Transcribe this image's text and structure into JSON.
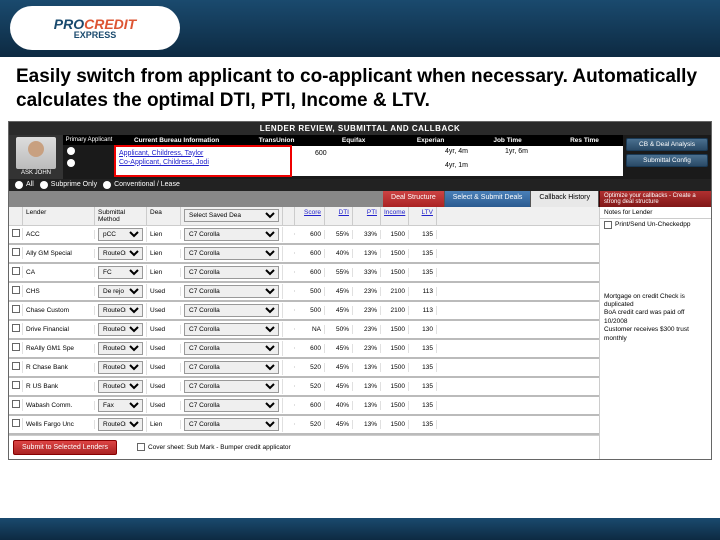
{
  "logo": {
    "line1": "PROCREDIT",
    "line2": "EXPRESS"
  },
  "headline": "Easily switch from applicant to co-applicant when necessary. Automatically calculates the optimal DTI, PTI, Income & LTV.",
  "app_title": "LENDER REVIEW, SUBMITTAL AND CALLBACK",
  "avatar_label": "ASK JOHN",
  "primary_header": "Primary Applicant",
  "bureau_headers": {
    "cb": "Current Bureau Information",
    "trans": "TransUnion",
    "equifax": "Equifax",
    "experian": "Experian",
    "job": "Job Time",
    "res": "Res Time"
  },
  "applicants": {
    "primary": {
      "name": "Applicant, Childress, Taylor",
      "trans": "",
      "equifax": "",
      "experian": "",
      "job": "4yr, 4m",
      "res": "1yr, 6m"
    },
    "co": {
      "name": "Co-Applicant, Childress, Jodi",
      "trans": "600",
      "equifax": "",
      "experian": "",
      "job": "4yr, 1m",
      "res": ""
    }
  },
  "right_buttons": {
    "cb": "CB & Deal Analysis",
    "submittal": "Submittal Config"
  },
  "filter": {
    "all": "All",
    "subprime": "Subprime Only",
    "conventional": "Conventional / Lease"
  },
  "tabs": {
    "deal": "Deal Structure",
    "select": "Select & Submit Deals",
    "callback": "Callback History"
  },
  "opt_banner": "Optimize your callbacks - Create a strong deal structure",
  "grid_headers": {
    "lender": "Lender",
    "method": "Submittal Method",
    "dea": "Dea",
    "deal_select": "Select Saved Dea",
    "score": "Score",
    "dti": "DTI",
    "pti": "PTI",
    "income": "Income",
    "ltv": "LTV"
  },
  "notes_header": "Notes for Lender",
  "print_label": "Print/Send Un-Checkedpp",
  "lenders": [
    {
      "name": "ACC",
      "method": "pCC",
      "dea": "Lien",
      "deal": "C7 Corolla",
      "score": "600",
      "dti": "55%",
      "pti": "33%",
      "income": "1500",
      "ltv": "135"
    },
    {
      "name": "Ally GM Special",
      "method": "RouteOne",
      "dea": "Lien",
      "deal": "C7 Corolla",
      "score": "600",
      "dti": "40%",
      "pti": "13%",
      "income": "1500",
      "ltv": "135"
    },
    {
      "name": "CA",
      "method": "FC",
      "dea": "Lien",
      "deal": "C7 Corolla",
      "score": "600",
      "dti": "55%",
      "pti": "33%",
      "income": "1500",
      "ltv": "135"
    },
    {
      "name": "CHS",
      "method": "De rejo",
      "dea": "Used",
      "deal": "C7 Corolla",
      "score": "500",
      "dti": "45%",
      "pti": "23%",
      "income": "2100",
      "ltv": "113"
    },
    {
      "name": "Chase Custom",
      "method": "RouteOne",
      "dea": "Used",
      "deal": "C7 Corolla",
      "score": "500",
      "dti": "45%",
      "pti": "23%",
      "income": "2100",
      "ltv": "113"
    },
    {
      "name": "Drive Financial",
      "method": "RouteOne",
      "dea": "Used",
      "deal": "C7 Corolla",
      "score": "NA",
      "dti": "50%",
      "pti": "23%",
      "income": "1500",
      "ltv": "130"
    },
    {
      "name": "ReAlly GM1 Spe",
      "method": "RouteOne",
      "dea": "Used",
      "deal": "C7 Corolla",
      "score": "600",
      "dti": "45%",
      "pti": "23%",
      "income": "1500",
      "ltv": "135"
    },
    {
      "name": "R Chase Bank",
      "method": "RouteOne",
      "dea": "Used",
      "deal": "C7 Corolla",
      "score": "520",
      "dti": "45%",
      "pti": "13%",
      "income": "1500",
      "ltv": "135"
    },
    {
      "name": "R US Bank",
      "method": "RouteOne",
      "dea": "Used",
      "deal": "C7 Corolla",
      "score": "520",
      "dti": "45%",
      "pti": "13%",
      "income": "1500",
      "ltv": "135"
    },
    {
      "name": "Wabash Comm.",
      "method": "Fax",
      "dea": "Used",
      "deal": "C7 Corolla",
      "score": "600",
      "dti": "40%",
      "pti": "13%",
      "income": "1500",
      "ltv": "135"
    },
    {
      "name": "Wells Fargo Unc",
      "method": "RouteOne",
      "dea": "Lien",
      "deal": "C7 Corolla",
      "score": "520",
      "dti": "45%",
      "pti": "13%",
      "income": "1500",
      "ltv": "135"
    }
  ],
  "notes": [
    "Mortgage on credit Check is duplicated",
    "BoA credit card was paid off 10/2008",
    "Customer receives $300 trust monthly"
  ],
  "submit_button": "Submit to Selected Lenders",
  "footer_check": "Cover sheet: Sub Mark - Bumper credit applicator"
}
